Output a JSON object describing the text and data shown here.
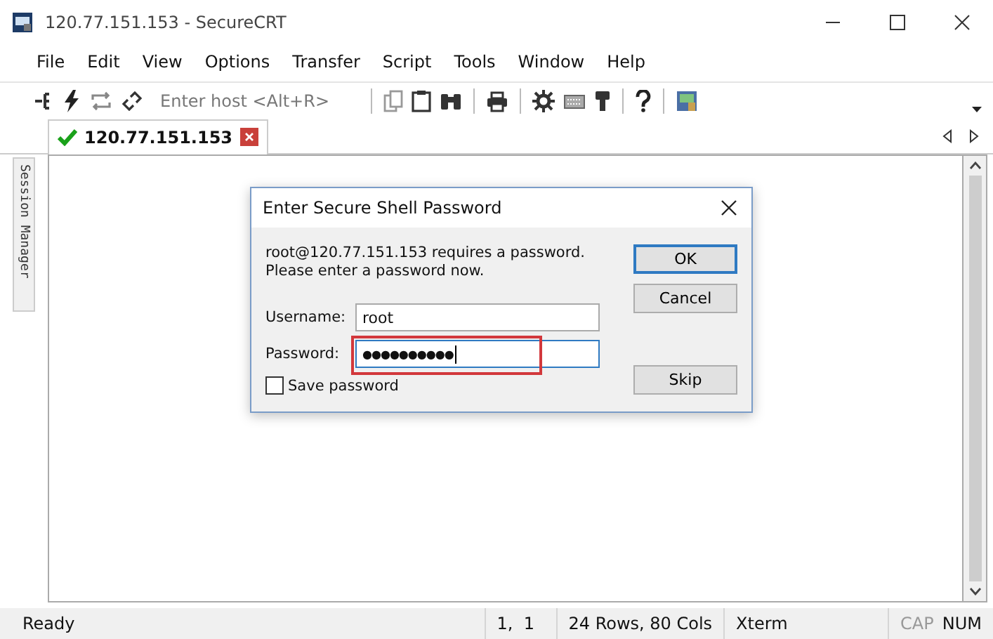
{
  "window": {
    "title": "120.77.151.153 - SecureCRT"
  },
  "menu": [
    "File",
    "Edit",
    "View",
    "Options",
    "Transfer",
    "Script",
    "Tools",
    "Window",
    "Help"
  ],
  "toolbar": {
    "host_field": {
      "placeholder": "Enter host <Alt+R>"
    }
  },
  "tabs": [
    {
      "label": "120.77.151.153",
      "selected": true,
      "connected": true
    }
  ],
  "sidebar": {
    "label": "Session Manager"
  },
  "dialog": {
    "title": "Enter Secure Shell Password",
    "message": "root@120.77.151.153 requires a password.\nPlease enter a password now.",
    "fields": [
      {
        "label": "Username:",
        "value": "root",
        "highlighted": false
      },
      {
        "label": "Password:",
        "value": "●●●●●●●●●●",
        "highlighted": true
      }
    ],
    "save_password": {
      "label": "Save password",
      "checked": false
    },
    "buttons": [
      {
        "label": "OK",
        "default": true
      },
      {
        "label": "Cancel",
        "default": false
      },
      {
        "label": "Skip",
        "default": false
      }
    ]
  },
  "status_bar": {
    "message": "Ready",
    "cursor": "1,  1",
    "size": "24 Rows, 80 Cols",
    "terminal": "Xterm",
    "indicators": [
      {
        "label": "CAP",
        "on": false
      },
      {
        "label": "NUM",
        "on": true
      }
    ]
  }
}
